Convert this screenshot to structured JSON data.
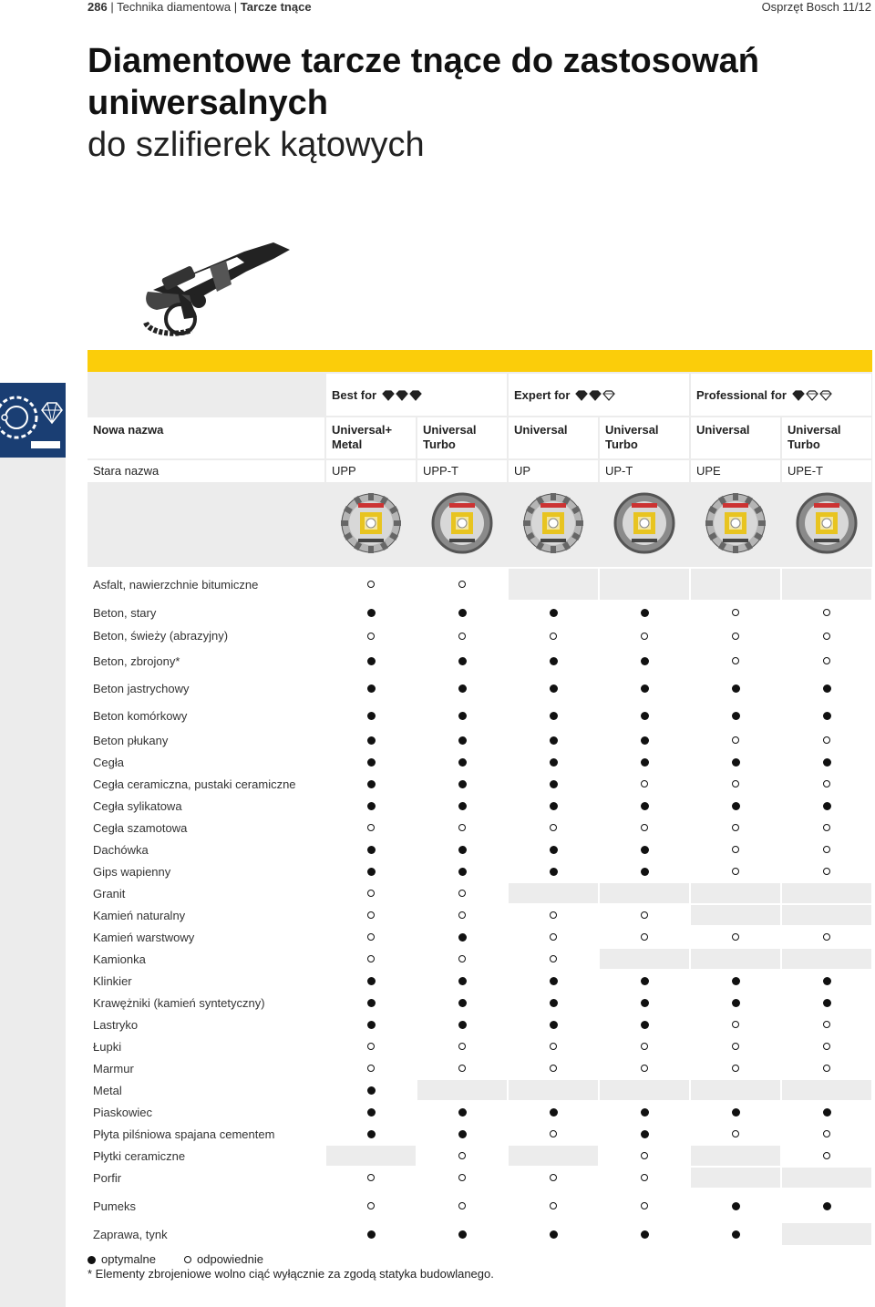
{
  "header": {
    "page_number": "286",
    "breadcrumb_section": "Technika diamentowa",
    "breadcrumb_page": "Tarcze tnące",
    "catalog": "Osprzęt Bosch 11/12"
  },
  "title": {
    "line1": "Diamentowe tarcze tnące do zastosowań",
    "line2": "uniwersalnych",
    "line3": "do szlifierek kątowych"
  },
  "groups": [
    {
      "label": "Best for",
      "icon": "diamond-rating-3"
    },
    {
      "label": "Expert for",
      "icon": "diamond-rating-2"
    },
    {
      "label": "Professional for",
      "icon": "diamond-rating-1"
    }
  ],
  "rows_header": {
    "new_name_label": "Nowa nazwa",
    "old_name_label": "Stara nazwa"
  },
  "products": [
    {
      "new1": "Universal+",
      "new2": "Metal",
      "old": "UPP"
    },
    {
      "new1": "Universal",
      "new2": "Turbo",
      "old": "UPP-T"
    },
    {
      "new1": "Universal",
      "new2": "",
      "old": "UP"
    },
    {
      "new1": "Universal",
      "new2": "Turbo",
      "old": "UP-T"
    },
    {
      "new1": "Universal",
      "new2": "",
      "old": "UPE"
    },
    {
      "new1": "Universal",
      "new2": "Turbo",
      "old": "UPE-T"
    }
  ],
  "materials": [
    {
      "name": "Asfalt, nawierzchnie bitumiczne",
      "v": [
        "o",
        "o",
        "",
        "",
        "",
        ""
      ]
    },
    {
      "name": "Beton, stary",
      "v": [
        "f",
        "f",
        "f",
        "f",
        "o",
        "o"
      ]
    },
    {
      "name": "Beton, świeży (abrazyjny)",
      "v": [
        "o",
        "o",
        "o",
        "o",
        "o",
        "o"
      ]
    },
    {
      "name": "Beton, zbrojony*",
      "v": [
        "f",
        "f",
        "f",
        "f",
        "o",
        "o"
      ]
    },
    {
      "name": "Beton jastrychowy",
      "v": [
        "f",
        "f",
        "f",
        "f",
        "f",
        "f"
      ]
    },
    {
      "name": "Beton komórkowy",
      "v": [
        "f",
        "f",
        "f",
        "f",
        "f",
        "f"
      ]
    },
    {
      "name": "Beton płukany",
      "v": [
        "f",
        "f",
        "f",
        "f",
        "o",
        "o"
      ]
    },
    {
      "name": "Cegła",
      "v": [
        "f",
        "f",
        "f",
        "f",
        "f",
        "f"
      ]
    },
    {
      "name": "Cegła ceramiczna, pustaki ceramiczne",
      "v": [
        "f",
        "f",
        "f",
        "o",
        "o",
        "o"
      ]
    },
    {
      "name": "Cegła sylikatowa",
      "v": [
        "f",
        "f",
        "f",
        "f",
        "f",
        "f"
      ]
    },
    {
      "name": "Cegła szamotowa",
      "v": [
        "o",
        "o",
        "o",
        "o",
        "o",
        "o"
      ]
    },
    {
      "name": "Dachówka",
      "v": [
        "f",
        "f",
        "f",
        "f",
        "o",
        "o"
      ]
    },
    {
      "name": "Gips wapienny",
      "v": [
        "f",
        "f",
        "f",
        "f",
        "o",
        "o"
      ]
    },
    {
      "name": "Granit",
      "v": [
        "o",
        "o",
        "",
        "",
        "",
        ""
      ]
    },
    {
      "name": "Kamień naturalny",
      "v": [
        "o",
        "o",
        "o",
        "o",
        "",
        ""
      ]
    },
    {
      "name": "Kamień warstwowy",
      "v": [
        "o",
        "f",
        "o",
        "o",
        "o",
        "o"
      ]
    },
    {
      "name": "Kamionka",
      "v": [
        "o",
        "o",
        "o",
        "",
        "",
        ""
      ]
    },
    {
      "name": "Klinkier",
      "v": [
        "f",
        "f",
        "f",
        "f",
        "f",
        "f"
      ]
    },
    {
      "name": "Krawężniki (kamień syntetyczny)",
      "v": [
        "f",
        "f",
        "f",
        "f",
        "f",
        "f"
      ]
    },
    {
      "name": "Lastryko",
      "v": [
        "f",
        "f",
        "f",
        "f",
        "o",
        "o"
      ]
    },
    {
      "name": "Łupki",
      "v": [
        "o",
        "o",
        "o",
        "o",
        "o",
        "o"
      ]
    },
    {
      "name": "Marmur",
      "v": [
        "o",
        "o",
        "o",
        "o",
        "o",
        "o"
      ]
    },
    {
      "name": "Metal",
      "v": [
        "f",
        "",
        "",
        "",
        "",
        ""
      ]
    },
    {
      "name": "Piaskowiec",
      "v": [
        "f",
        "f",
        "f",
        "f",
        "f",
        "f"
      ]
    },
    {
      "name": "Płyta pilśniowa spajana cementem",
      "v": [
        "f",
        "f",
        "o",
        "f",
        "o",
        "o"
      ]
    },
    {
      "name": "Płytki ceramiczne",
      "v": [
        "",
        "o",
        "",
        "o",
        "",
        "o"
      ]
    },
    {
      "name": "Porfir",
      "v": [
        "o",
        "o",
        "o",
        "o",
        "",
        ""
      ]
    },
    {
      "name": "Pumeks",
      "v": [
        "o",
        "o",
        "o",
        "o",
        "f",
        "f"
      ]
    },
    {
      "name": "Zaprawa, tynk",
      "v": [
        "f",
        "f",
        "f",
        "f",
        "f",
        ""
      ]
    }
  ],
  "legend": {
    "optimal": "optymalne",
    "suitable": "odpowiednie",
    "footnote": "* Elementy zbrojeniowe wolno ciąć wyłącznie za zgodą statyka budowlanego."
  },
  "colors": {
    "yellow_band": "#fbcd0a",
    "side_tab": "#1a3e73",
    "cell_gray": "#ececec"
  }
}
